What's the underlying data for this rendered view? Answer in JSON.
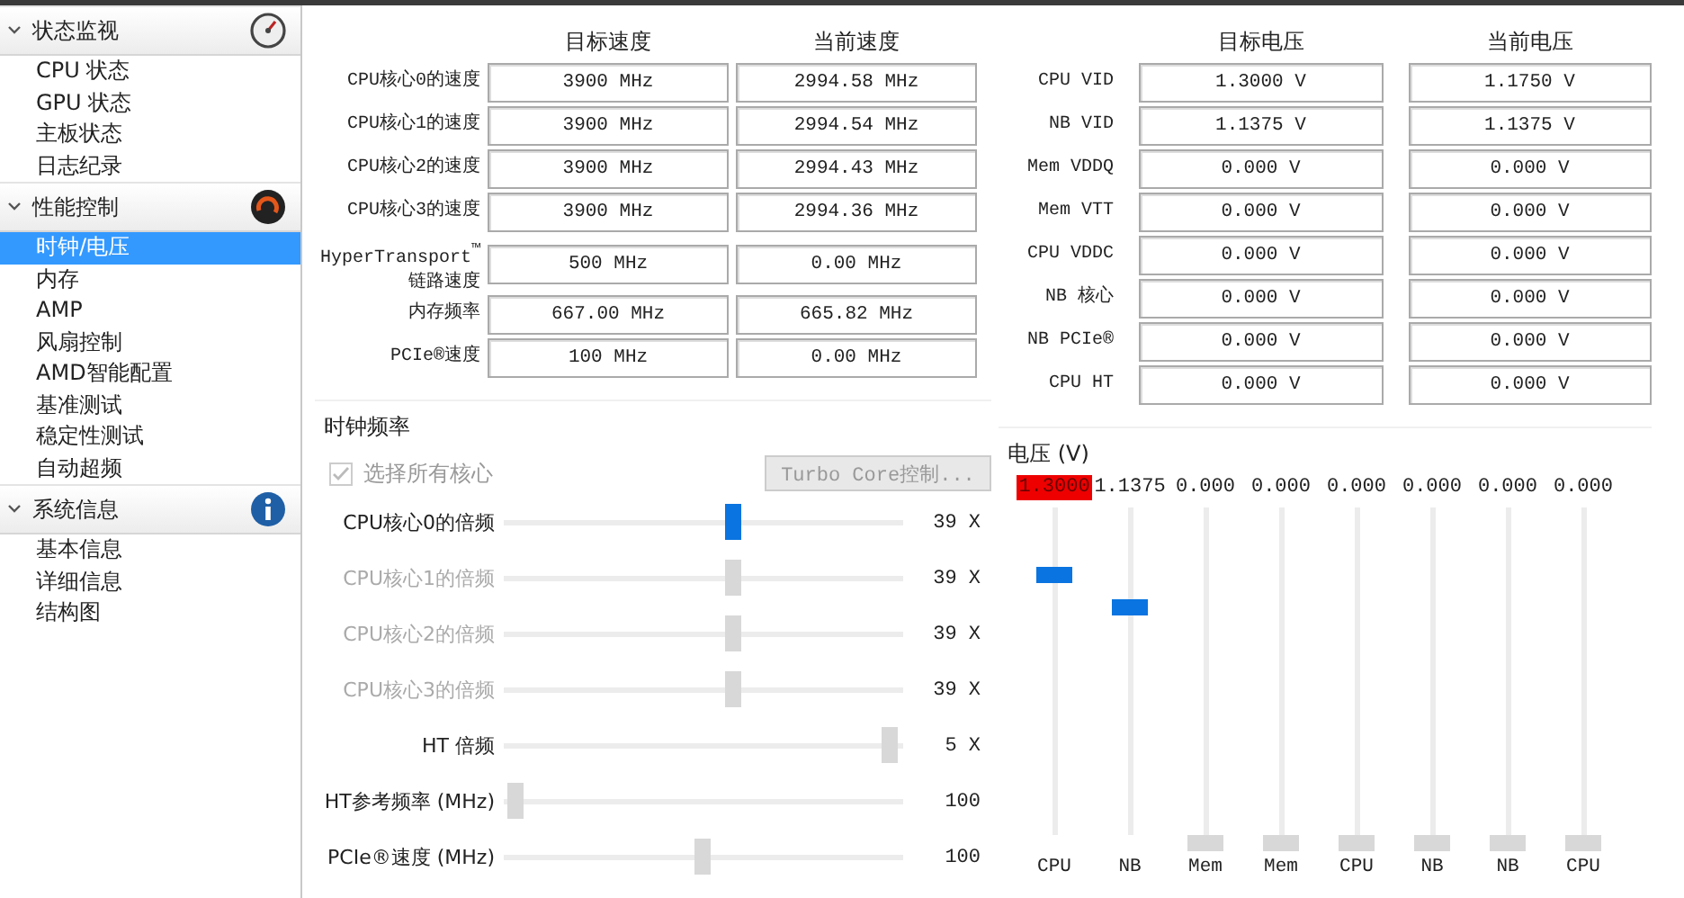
{
  "sidebar": {
    "sections": [
      {
        "title": "状态监视",
        "expanded": true,
        "items": [
          {
            "label": "CPU 状态",
            "selected": false
          },
          {
            "label": "GPU 状态",
            "selected": false
          },
          {
            "label": "主板状态",
            "selected": false
          },
          {
            "label": "日志纪录",
            "selected": false
          }
        ]
      },
      {
        "title": "性能控制",
        "expanded": true,
        "items": [
          {
            "label": "时钟/电压",
            "selected": true
          },
          {
            "label": "内存",
            "selected": false
          },
          {
            "label": "AMP",
            "selected": false
          },
          {
            "label": "风扇控制",
            "selected": false
          },
          {
            "label": "AMD智能配置",
            "selected": false
          },
          {
            "label": "基准测试",
            "selected": false
          },
          {
            "label": "稳定性测试",
            "selected": false
          },
          {
            "label": "自动超频",
            "selected": false
          }
        ]
      },
      {
        "title": "系统信息",
        "expanded": true,
        "items": [
          {
            "label": "基本信息",
            "selected": false
          },
          {
            "label": "详细信息",
            "selected": false
          },
          {
            "label": "结构图",
            "selected": false
          }
        ]
      }
    ]
  },
  "speed_table": {
    "columns": [
      "目标速度",
      "当前速度"
    ],
    "rows": [
      {
        "label": "CPU核心0的速度",
        "target": "3900 MHz",
        "current": "2994.58 MHz"
      },
      {
        "label": "CPU核心1的速度",
        "target": "3900 MHz",
        "current": "2994.54 MHz"
      },
      {
        "label": "CPU核心2的速度",
        "target": "3900 MHz",
        "current": "2994.43 MHz"
      },
      {
        "label": "CPU核心3的速度",
        "target": "3900 MHz",
        "current": "2994.36 MHz"
      },
      {
        "label": "HyperTransport$^{™}$\n链路速度",
        "target": "500 MHz",
        "current": "0.00 MHz"
      },
      {
        "label": "内存频率",
        "target": "667.00 MHz",
        "current": "665.82 MHz"
      },
      {
        "label": "PCIe®速度",
        "target": "100 MHz",
        "current": "0.00 MHz"
      }
    ]
  },
  "voltage_table": {
    "columns": [
      "目标电压",
      "当前电压"
    ],
    "rows": [
      {
        "label": "CPU VID",
        "target": "1.3000 V",
        "current": "1.1750 V"
      },
      {
        "label": "NB VID",
        "target": "1.1375 V",
        "current": "1.1375 V"
      },
      {
        "label": "Mem VDDQ",
        "target": "0.000 V",
        "current": "0.000 V"
      },
      {
        "label": "Mem VTT",
        "target": "0.000 V",
        "current": "0.000 V"
      },
      {
        "label": "CPU VDDC",
        "target": "0.000 V",
        "current": "0.000 V"
      },
      {
        "label": "NB 核心",
        "target": "0.000 V",
        "current": "0.000 V"
      },
      {
        "label": "NB PCIe®",
        "target": "0.000 V",
        "current": "0.000 V"
      },
      {
        "label": "CPU HT",
        "target": "0.000 V",
        "current": "0.000 V"
      }
    ]
  },
  "clock_frequency": {
    "title": "时钟频率",
    "select_all": {
      "label": "选择所有核心",
      "checked": true,
      "disabled": true
    },
    "turbo_button": {
      "label": "Turbo Core控制...",
      "disabled": true
    },
    "sliders": [
      {
        "label": "CPU核心0的倍频",
        "level": 0.58,
        "reading": "39 X",
        "disabled": false,
        "active": true
      },
      {
        "label": "CPU核心1的倍频",
        "level": 0.58,
        "reading": "39 X",
        "disabled": true,
        "active": false
      },
      {
        "label": "CPU核心2的倍频",
        "level": 0.58,
        "reading": "39 X",
        "disabled": true,
        "active": false
      },
      {
        "label": "CPU核心3的倍频",
        "level": 0.58,
        "reading": "39 X",
        "disabled": true,
        "active": false
      },
      {
        "label": "HT 倍频",
        "level": 1,
        "reading": "5 X",
        "disabled": false,
        "active": false
      },
      {
        "label": "HT参考频率 (MHz)",
        "level": 0,
        "reading": "100",
        "disabled": false,
        "active": false
      },
      {
        "label": "PCIe®速度 (MHz)",
        "level": 0.5,
        "reading": "100",
        "disabled": false,
        "active": false
      }
    ]
  },
  "voltage_sliders": {
    "title": "电压 (V)",
    "sliders": [
      {
        "reading": "1.3000",
        "label": "CPU",
        "level": 0.82,
        "active": true,
        "warning": true
      },
      {
        "reading": "1.1375",
        "label": "NB",
        "level": 0.72,
        "active": true,
        "warning": false
      },
      {
        "reading": "0.000",
        "label": "Mem",
        "level": 0,
        "active": false,
        "warning": false
      },
      {
        "reading": "0.000",
        "label": "Mem",
        "level": 0,
        "active": false,
        "warning": false
      },
      {
        "reading": "0.000",
        "label": "CPU",
        "level": 0,
        "active": false,
        "warning": false
      },
      {
        "reading": "0.000",
        "label": "NB",
        "level": 0,
        "active": false,
        "warning": false
      },
      {
        "reading": "0.000",
        "label": "NB",
        "level": 0,
        "active": false,
        "warning": false
      },
      {
        "reading": "0.000",
        "label": "CPU",
        "level": 0,
        "active": false,
        "warning": false
      }
    ]
  }
}
